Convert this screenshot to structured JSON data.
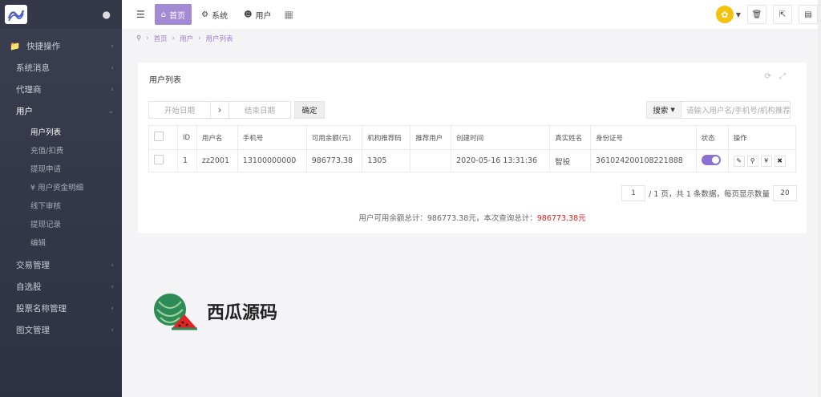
{
  "sidebar": {
    "menu": [
      {
        "label": "快捷操作",
        "icon": "folder-icon"
      },
      {
        "label": "系统消息"
      },
      {
        "label": "代理商"
      },
      {
        "label": "用户",
        "open": true
      }
    ],
    "sub": [
      "用户列表",
      "充值/扣费",
      "提现申请",
      "¥ 用户资金明细",
      "线下审核",
      "提现记录",
      "编辑"
    ],
    "menu2": [
      "交易管理",
      "自选股",
      "股票名称管理",
      "图文管理"
    ]
  },
  "topbar": {
    "tabs": [
      {
        "label": "首页",
        "icon": "home-icon",
        "active": true
      },
      {
        "label": "系统",
        "icon": "gear-icon"
      },
      {
        "label": "用户",
        "icon": "user-icon"
      }
    ]
  },
  "breadcrumb": [
    "首页",
    "用户",
    "用户列表"
  ],
  "panel": {
    "title": "用户列表",
    "start_date": "开始日期",
    "end_date": "结束日期",
    "confirm": "确定",
    "search_label": "搜索",
    "search_placeholder": "请输入用户名/手机号/机构推荐"
  },
  "table": {
    "headers": [
      "",
      "ID",
      "用户名",
      "手机号",
      "可用余额(元)",
      "机构推荐码",
      "推荐用户",
      "创建时间",
      "真实姓名",
      "身份证号",
      "状态",
      "操作"
    ],
    "rows": [
      [
        "",
        "1",
        "zz2001",
        "13100000000",
        "986773.38",
        "1305",
        "",
        "2020-05-16 13:31:36",
        "智投",
        "361024200108221888",
        "",
        ""
      ]
    ]
  },
  "pager": {
    "page": "1",
    "total_text": "/ 1 页，共 1 条数据，每页显示数量",
    "per_page": "20"
  },
  "summary": {
    "text": "用户可用余额总计：986773.38元，本次查询总计：",
    "red": "986773.38元"
  },
  "watermark": "西瓜源码",
  "colors": {
    "accent": "#a48ad4",
    "sidebar": "#343848",
    "red": "#e02020"
  }
}
